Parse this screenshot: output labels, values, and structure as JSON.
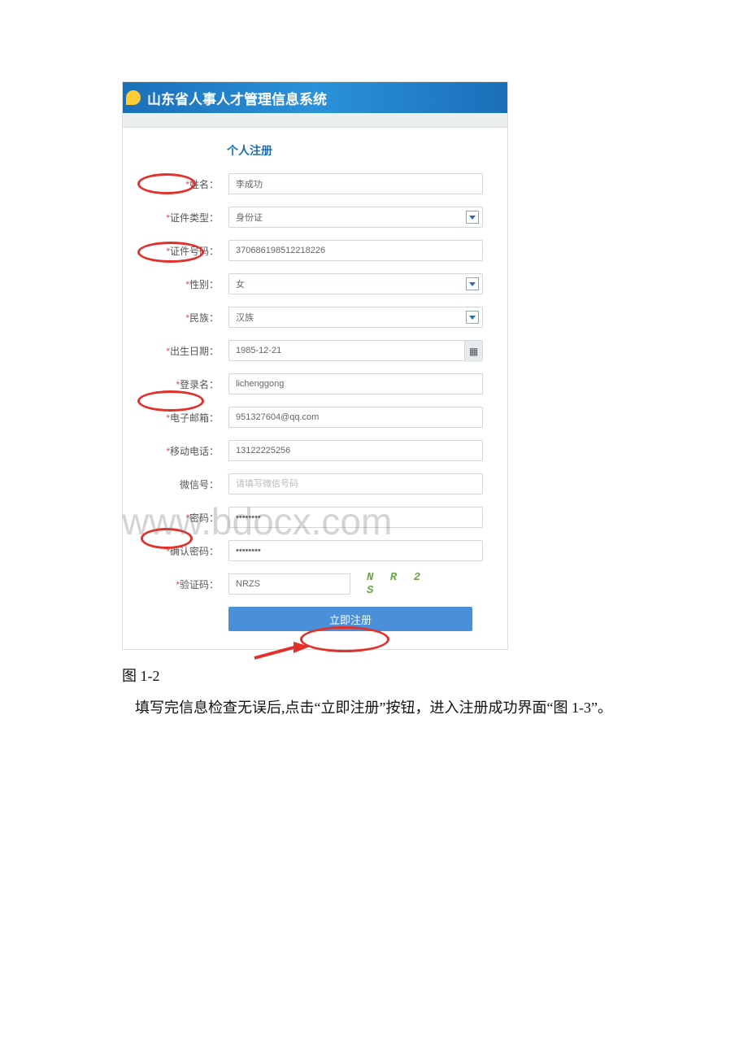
{
  "header": {
    "title": "山东省人事人才管理信息系统"
  },
  "tab": {
    "title": "个人注册"
  },
  "fields": {
    "name": {
      "label": "姓名：",
      "value": "李成功"
    },
    "idtype": {
      "label": "证件类型：",
      "value": "身份证"
    },
    "idno": {
      "label": "证件号码：",
      "value": "370686198512218226"
    },
    "gender": {
      "label": "性别：",
      "value": "女"
    },
    "ethnic": {
      "label": "民族：",
      "value": "汉族"
    },
    "dob": {
      "label": "出生日期：",
      "value": "1985-12-21"
    },
    "login": {
      "label": "登录名：",
      "value": "lichenggong"
    },
    "email": {
      "label": "电子邮箱：",
      "value": "951327604@qq.com"
    },
    "mobile": {
      "label": "移动电话：",
      "value": "13122225256"
    },
    "wechat": {
      "label": "微信号：",
      "placeholder": "请填写微信号码"
    },
    "pwd": {
      "label": "密码：",
      "value": "********"
    },
    "pwd2": {
      "label": "确认密码：",
      "value": "********"
    },
    "captcha": {
      "label": "验证码：",
      "value": "NRZS",
      "image_text": "N R 2 S"
    }
  },
  "submit": {
    "label": "立即注册"
  },
  "required_mark": "*",
  "caption": "图 1-2",
  "body_text": "填写完信息检查无误后,点击“立即注册”按钮，进入注册成功界面“图 1-3”。",
  "watermark": "www.bdocx.com"
}
